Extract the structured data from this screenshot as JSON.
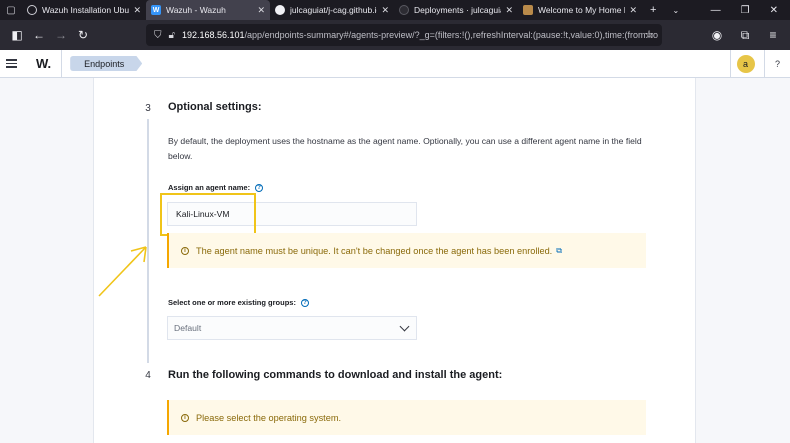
{
  "browser": {
    "tabs": [
      {
        "title": "Wazuh Installation Ubunt",
        "icon": "globe-icon",
        "active": false
      },
      {
        "title": "Wazuh - Wazuh",
        "icon": "wazuh-favicon",
        "active": true
      },
      {
        "title": "julcaguiat/j-cag.github.io",
        "icon": "github-icon",
        "active": false
      },
      {
        "title": "Deployments · julcaguiat/j",
        "icon": "github-icon",
        "active": false
      },
      {
        "title": "Welcome to My Home Lal",
        "icon": "page-icon",
        "active": false
      }
    ],
    "url_host": "192.168.56.101",
    "url_path": "/app/endpoints-summary#/agents-preview/?_g=(filters:!(),refreshInterval:(pause:!t,value:0),time:(from:no"
  },
  "app": {
    "logo": "W.",
    "breadcrumb": "Endpoints",
    "avatar_initial": "a",
    "help_glyph": "?"
  },
  "step3": {
    "number": "3",
    "heading": "Optional settings:",
    "description": "By default, the deployment uses the hostname as the agent name. Optionally, you can use a different agent name in the field below.",
    "agent_name_label": "Assign an agent name:",
    "agent_name_value": "Kali-Linux-VM",
    "warning": "The agent name must be unique. It can't be changed once the agent has been enrolled.",
    "groups_label": "Select one or more existing groups:",
    "groups_value": "Default"
  },
  "step4": {
    "number": "4",
    "heading": "Run the following commands to download and install the agent:",
    "notice": "Please select the operating system."
  },
  "colors": {
    "highlight": "#f0c419",
    "callout_bg": "#fff9e8",
    "callout_border": "#f5a700",
    "link": "#006bb8"
  }
}
